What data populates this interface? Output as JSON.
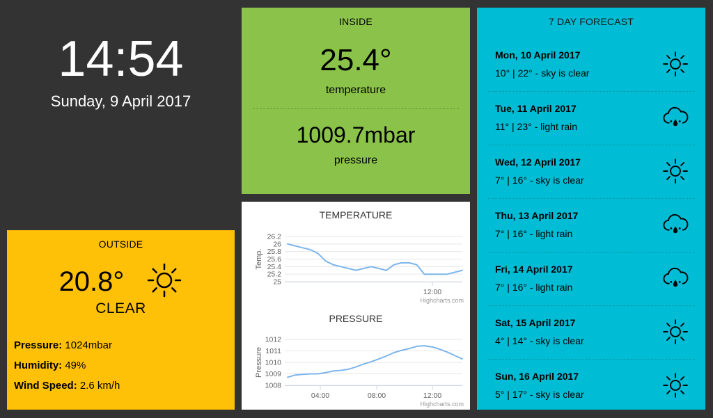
{
  "clock": {
    "time": "14:54",
    "date": "Sunday, 9 April 2017"
  },
  "outside": {
    "title": "OUTSIDE",
    "temperature": "20.8°",
    "condition": "CLEAR",
    "icon": "sun-icon",
    "pressure_label": "Pressure:",
    "pressure_value": "1024mbar",
    "humidity_label": "Humidity:",
    "humidity_value": "49%",
    "wind_label": "Wind Speed:",
    "wind_value": "2.6 km/h"
  },
  "inside": {
    "title": "INSIDE",
    "temperature": "25.4°",
    "temperature_label": "temperature",
    "pressure": "1009.7mbar",
    "pressure_label": "pressure"
  },
  "chart_data": [
    {
      "type": "line",
      "title": "TEMPERATURE",
      "ylabel": "Temp.",
      "xlabel": "",
      "credit": "Highcharts.com",
      "y_ticks": [
        "26.2",
        "26",
        "25.8",
        "25.6",
        "25.4",
        "25.2",
        "25"
      ],
      "x_ticks": [
        "12:00"
      ],
      "ylim": [
        25,
        26.2
      ],
      "x": [
        "02:00",
        "02:30",
        "03:00",
        "03:30",
        "04:00",
        "04:30",
        "05:00",
        "05:30",
        "06:00",
        "06:30",
        "07:00",
        "07:30",
        "08:00",
        "08:30",
        "09:00",
        "09:30",
        "10:00",
        "10:30",
        "11:00",
        "11:30",
        "12:00",
        "12:30",
        "13:00",
        "13:30"
      ],
      "series": [
        {
          "values": [
            26.0,
            25.95,
            25.9,
            25.85,
            25.75,
            25.55,
            25.45,
            25.4,
            25.35,
            25.3,
            25.35,
            25.4,
            25.35,
            25.3,
            25.45,
            25.5,
            25.5,
            25.45,
            25.2,
            25.2,
            25.2,
            25.2,
            25.25,
            25.3
          ]
        }
      ],
      "color": "#7cb5ec"
    },
    {
      "type": "line",
      "title": "PRESSURE",
      "ylabel": "Pressure",
      "xlabel": "",
      "credit": "Highcharts.com",
      "y_ticks": [
        "1012",
        "1011",
        "1010",
        "1009",
        "1008"
      ],
      "x_ticks": [
        "04:00",
        "08:00",
        "12:00"
      ],
      "ylim": [
        1008,
        1012
      ],
      "x": [
        "02:00",
        "02:30",
        "03:00",
        "03:30",
        "04:00",
        "04:30",
        "05:00",
        "05:30",
        "06:00",
        "06:30",
        "07:00",
        "07:30",
        "08:00",
        "08:30",
        "09:00",
        "09:30",
        "10:00",
        "10:30",
        "11:00",
        "11:30",
        "12:00",
        "12:30",
        "13:00",
        "13:30"
      ],
      "series": [
        {
          "values": [
            1008.7,
            1008.9,
            1008.95,
            1009.0,
            1009.0,
            1009.1,
            1009.25,
            1009.3,
            1009.4,
            1009.6,
            1009.85,
            1010.05,
            1010.3,
            1010.55,
            1010.85,
            1011.05,
            1011.2,
            1011.4,
            1011.45,
            1011.35,
            1011.15,
            1010.9,
            1010.6,
            1010.3
          ]
        }
      ],
      "color": "#7cb5ec"
    }
  ],
  "forecast": {
    "title": "7 DAY FORECAST",
    "days": [
      {
        "day": "Mon, 10 April 2017",
        "desc": "10° | 22° - sky is clear",
        "icon": "sun-icon"
      },
      {
        "day": "Tue, 11 April 2017",
        "desc": "11° | 23° - light rain",
        "icon": "rain-cloud-icon"
      },
      {
        "day": "Wed, 12 April 2017",
        "desc": "7° | 16° - sky is clear",
        "icon": "sun-icon"
      },
      {
        "day": "Thu, 13 April 2017",
        "desc": "7° | 16° - light rain",
        "icon": "rain-cloud-icon"
      },
      {
        "day": "Fri, 14 April 2017",
        "desc": "7° | 16° - light rain",
        "icon": "rain-cloud-icon"
      },
      {
        "day": "Sat, 15 April 2017",
        "desc": "4° | 14° - sky is clear",
        "icon": "sun-icon"
      },
      {
        "day": "Sun, 16 April 2017",
        "desc": "5° | 17° - sky is clear",
        "icon": "sun-icon"
      }
    ]
  }
}
